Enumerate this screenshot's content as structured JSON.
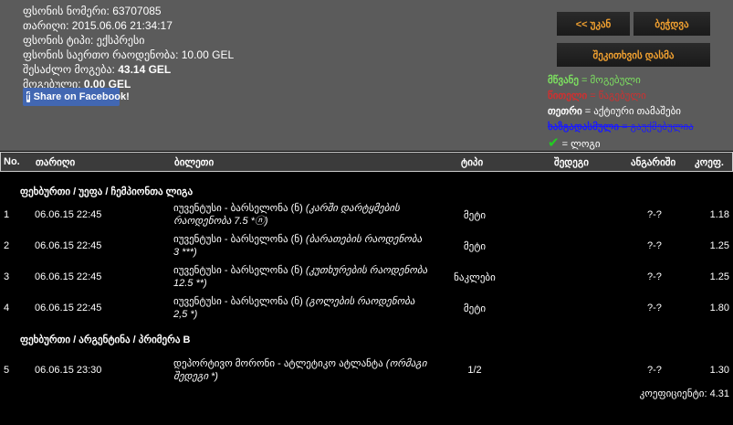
{
  "bet_info": [
    {
      "label": "ფსონის ნომერი:",
      "value": "63707085"
    },
    {
      "label": "თარიღი:",
      "value": "2015.06.06 21:34:17"
    },
    {
      "label": "ფსონის ტიპი:",
      "value": "ექსპრესი"
    },
    {
      "label": "ფსონის საერთო რაოდენობა:",
      "value": "10.00 GEL"
    },
    {
      "label": "შესაძლო მოგება:",
      "value": "43.14 GEL"
    },
    {
      "label": "მოგებული:",
      "value": "0.00 GEL"
    }
  ],
  "facebook_label": "Share on Facebook!",
  "buttons": {
    "back": "<< უკან",
    "print": "ბეჭდვა",
    "ask": "შეკითხვის დასმა"
  },
  "legend": [
    {
      "key": "მწვანე",
      "value": "მოგებული",
      "color": "#7de060"
    },
    {
      "key": "წითელი",
      "value": "წაგებული",
      "color": "#d03030"
    },
    {
      "key": "თეთრი",
      "value": "აქტიური თამაშები",
      "color": "#ffffff"
    },
    {
      "key": "ხაზგადასმული",
      "value": "გაუქმებულია",
      "color": "#1a1aff"
    },
    {
      "key": "✔",
      "value": "ლოგი",
      "color": "#22cc22"
    }
  ],
  "columns": [
    "No.",
    "თარიღი",
    "ბილეთი",
    "ტიპი",
    "შედეგი",
    "ანგარიში",
    "კოეფ."
  ],
  "sections": [
    {
      "title": "ფეხბურთი / უეფა / ჩემპიონთა ლიგა",
      "rows": [
        {
          "no": "1",
          "date": "06.06.15 22:45",
          "match": "იუვენტუსი - ბარსელონა (ნ)",
          "market": "(კარში დარტყმების რაოდენობა 7.5 *ⓝ)",
          "type": "მეტი",
          "result": "",
          "score": "?-?",
          "odds": "1.18"
        },
        {
          "no": "2",
          "date": "06.06.15 22:45",
          "match": "იუვენტუსი - ბარსელონა (ნ)",
          "market": "(ბარათების რაოდენობა 3 ***)",
          "type": "მეტი",
          "result": "",
          "score": "?-?",
          "odds": "1.25"
        },
        {
          "no": "3",
          "date": "06.06.15 22:45",
          "match": "იუვენტუსი - ბარსელონა (ნ)",
          "market": "(კუთხურების რაოდენობა 12.5 **)",
          "type": "ნაკლები",
          "result": "",
          "score": "?-?",
          "odds": "1.25"
        },
        {
          "no": "4",
          "date": "06.06.15 22:45",
          "match": "იუვენტუსი - ბარსელონა (ნ)",
          "market": "(გოლების რაოდენობა 2,5 *)",
          "type": "მეტი",
          "result": "",
          "score": "?-?",
          "odds": "1.80"
        }
      ]
    },
    {
      "title": "ფეხბურთი / არგენტინა / პრიმერა B",
      "rows": [
        {
          "no": "5",
          "date": "06.06.15 23:30",
          "match": "დეპორტივო მორონი - ატლეტიკო ატლანტა",
          "market": "(ორმაგი შედეგი *)",
          "type": "1/2",
          "result": "",
          "score": "?-?",
          "odds": "1.30"
        }
      ]
    }
  ],
  "total": {
    "label": "კოეფიციენტი:",
    "value": "4.31"
  }
}
